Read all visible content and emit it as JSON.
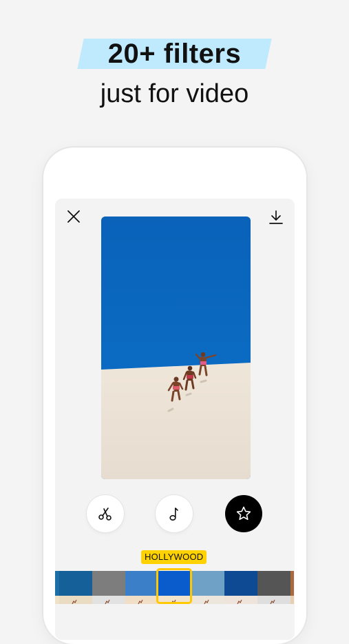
{
  "headline": {
    "title": "20+ filters",
    "subtitle": "just for video",
    "highlight_color": "#bfeafd"
  },
  "editor": {
    "close_icon": "close-icon",
    "download_icon": "download-icon",
    "tools": [
      {
        "name": "trim",
        "icon": "scissors-icon",
        "active": false
      },
      {
        "name": "music",
        "icon": "music-note-icon",
        "active": false
      },
      {
        "name": "filters",
        "icon": "star-icon",
        "active": true
      }
    ],
    "selected_filter": "HOLLYWOOD",
    "filter_badge_color": "#ffd200",
    "selection_color": "#ffc800"
  },
  "filters": {
    "thumbnails": [
      {
        "sky": "#1d6fa8",
        "sand": "#efe2c9"
      },
      {
        "sky": "#16609a",
        "sand": "#eadcc2"
      },
      {
        "sky": "#7d7d7d",
        "sand": "#e2e2e2"
      },
      {
        "sky": "#3b7fc8",
        "sand": "#f0dfc6"
      },
      {
        "sky": "#0a5ccc",
        "sand": "#f2e3cc"
      },
      {
        "sky": "#6fa1c7",
        "sand": "#ece6dc"
      },
      {
        "sky": "#0d4a93",
        "sand": "#efe4db"
      },
      {
        "sky": "#555555",
        "sand": "#dedede"
      },
      {
        "sky": "#a86a3e",
        "sand": "#e8cfb0"
      }
    ]
  },
  "colors": {
    "background": "#f4f4f4",
    "sky": "#0b6cc0",
    "sand": "#e9e0d4"
  }
}
